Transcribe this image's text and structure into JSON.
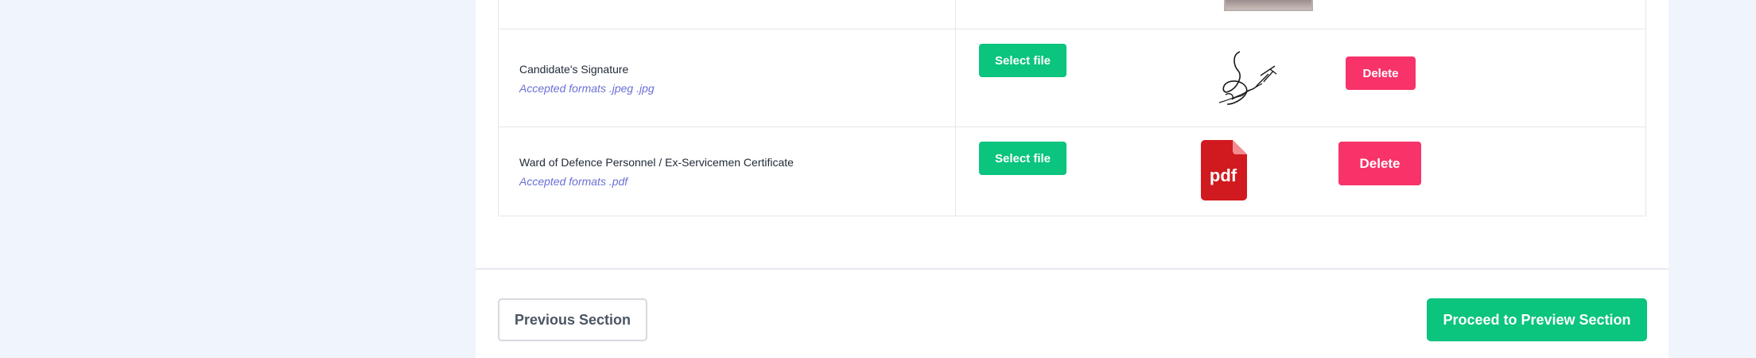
{
  "documents": [
    {
      "name": "Candidate's Signature",
      "hint": "Accepted formats .jpeg .jpg",
      "select_label": "Select file",
      "delete_label": "Delete",
      "preview": "signature-image"
    },
    {
      "name": "Ward of Defence Personnel / Ex-Servicemen Certificate",
      "hint": "Accepted formats .pdf",
      "select_label": "Select file",
      "delete_label": "Delete",
      "preview": "pdf-file-icon",
      "pdf_badge": "pdf"
    }
  ],
  "footer": {
    "previous_label": "Previous Section",
    "proceed_label": "Proceed to Preview Section"
  },
  "colors": {
    "background": "#f0f4fb",
    "accent_green": "#0bc47d",
    "delete_pink": "#f7336a",
    "hint_purple": "#6b6fd4",
    "pdf_red": "#d11a1f"
  }
}
